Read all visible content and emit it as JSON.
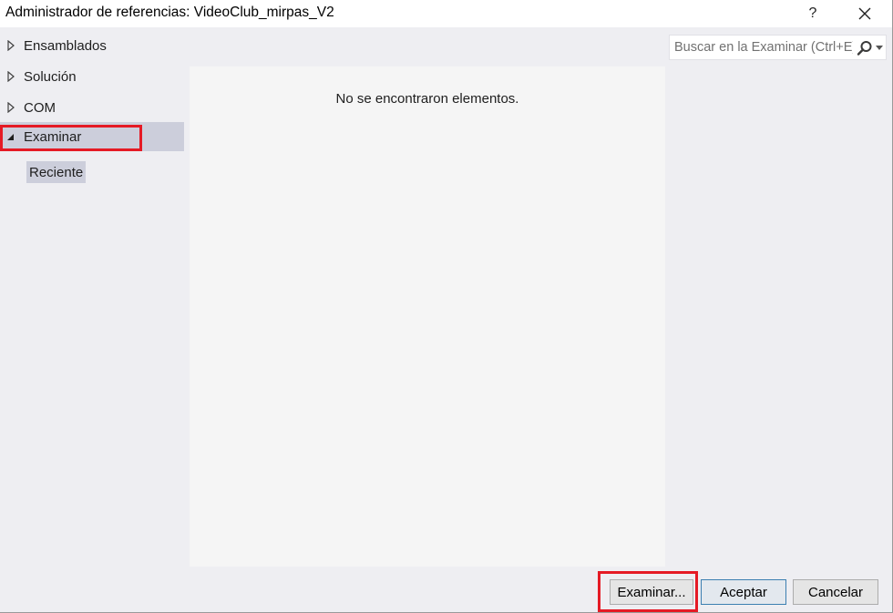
{
  "window": {
    "title": "Administrador de referencias: VideoClub_mirpas_V2",
    "help_label": "?"
  },
  "nav": {
    "items": [
      {
        "label": "Ensamblados",
        "expanded": false
      },
      {
        "label": "Solución",
        "expanded": false
      },
      {
        "label": "COM",
        "expanded": false
      },
      {
        "label": "Examinar",
        "expanded": true,
        "selected": true
      }
    ],
    "subitems": [
      {
        "label": "Reciente",
        "selected": true
      }
    ]
  },
  "search": {
    "placeholder": "Buscar en la Examinar (Ctrl+E)",
    "value": ""
  },
  "list": {
    "empty_message": "No se encontraron elementos."
  },
  "buttons": {
    "browse": "Examinar...",
    "ok": "Aceptar",
    "cancel": "Cancelar"
  },
  "colors": {
    "highlight_box": "#e51a25",
    "selected_bg": "#cccedb",
    "panel_bg": "#f5f5f5",
    "dialog_bg": "#eeeef2"
  },
  "icons": {
    "collapsed_arrow": "triangle-right-outline-icon",
    "expanded_arrow": "triangle-down-filled-icon",
    "search": "magnifier-icon",
    "dropdown": "chevron-down-icon",
    "close": "close-icon"
  }
}
